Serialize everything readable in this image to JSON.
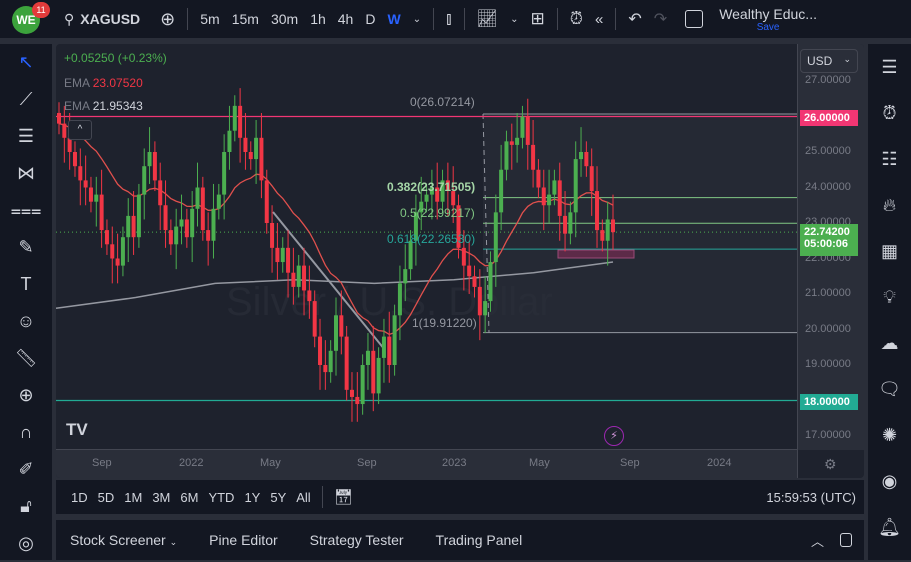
{
  "topbar": {
    "badge": "11",
    "logo": "WE",
    "symbol": "XAGUSD",
    "intervals": [
      "5m",
      "15m",
      "30m",
      "1h",
      "4h",
      "D",
      "W"
    ],
    "active_interval": "W",
    "account": "Wealthy Educ...",
    "save": "Save"
  },
  "legend": {
    "change": "+0.05250 (+0.23%)",
    "ema1_label": "EMA",
    "ema1_value": "23.07520",
    "ema2_label": "EMA",
    "ema2_value": "21.95343"
  },
  "currency": "USD",
  "price_axis": [
    "27.00000",
    "26.00000",
    "25.00000",
    "24.00000",
    "23.00000",
    "22.00000",
    "21.00000",
    "20.00000",
    "19.00000",
    "18.00000",
    "17.00000"
  ],
  "current_price": "22.74200",
  "countdown": "05:00:06",
  "time_axis": [
    "Sep",
    "2022",
    "May",
    "Sep",
    "2023",
    "May",
    "Sep",
    "2024"
  ],
  "fib": {
    "l0": "0(26.07214)",
    "l382": "0.382(23.71505)",
    "l5": "0.5(22.99217)",
    "l618": "0.618(22.26530)",
    "l1": "1(19.91220)"
  },
  "watermark": "Silver / U.S. Dollar",
  "range_buttons": [
    "1D",
    "5D",
    "1M",
    "3M",
    "6M",
    "YTD",
    "1Y",
    "5Y",
    "All"
  ],
  "clock": "15:59:53 (UTC)",
  "bottom_tabs": [
    "Stock Screener",
    "Pine Editor",
    "Strategy Tester",
    "Trading Panel"
  ],
  "colors": {
    "up": "#4caf50",
    "down": "#f23645",
    "ema_fast": "#e0504d",
    "ema_slow": "#9598a1",
    "resistance": "#f23673",
    "support": "#22ab94"
  },
  "chart_data": {
    "type": "candlestick",
    "symbol": "XAGUSD",
    "interval": "W",
    "ylim": [
      16.5,
      27.8
    ],
    "closes": [
      25.8,
      25.4,
      25.0,
      24.6,
      24.2,
      24.0,
      23.6,
      23.8,
      22.8,
      22.4,
      22.0,
      21.8,
      22.6,
      23.2,
      22.6,
      23.8,
      24.6,
      25.0,
      24.2,
      23.5,
      22.8,
      22.4,
      22.9,
      23.1,
      22.6,
      23.4,
      24.0,
      22.8,
      22.5,
      23.4,
      23.8,
      25.0,
      25.6,
      26.3,
      25.4,
      25.0,
      24.8,
      25.4,
      24.2,
      23.0,
      22.3,
      21.9,
      22.3,
      21.6,
      21.2,
      21.8,
      21.1,
      20.8,
      19.8,
      19.0,
      18.8,
      19.4,
      20.4,
      19.8,
      18.3,
      18.1,
      17.9,
      19.0,
      19.4,
      18.2,
      19.2,
      19.8,
      19.0,
      20.4,
      21.3,
      21.7,
      22.5,
      23.3,
      23.6,
      23.8,
      24.0,
      23.6,
      24.2,
      23.9,
      23.5,
      22.3,
      21.8,
      21.5,
      21.2,
      20.4,
      20.8,
      21.9,
      23.3,
      24.5,
      25.3,
      25.2,
      25.4,
      26.0,
      25.2,
      24.5,
      24.0,
      23.5,
      23.8,
      24.2,
      23.2,
      22.7,
      23.3,
      24.8,
      25.0,
      24.6,
      23.9,
      22.8,
      22.5,
      23.1,
      22.742
    ],
    "ema_slow": [
      20.6,
      20.9,
      21.3,
      21.4,
      21.3,
      21.4,
      21.6,
      21.9
    ],
    "levels": {
      "resistance": 26.0,
      "support": 18.0
    }
  }
}
